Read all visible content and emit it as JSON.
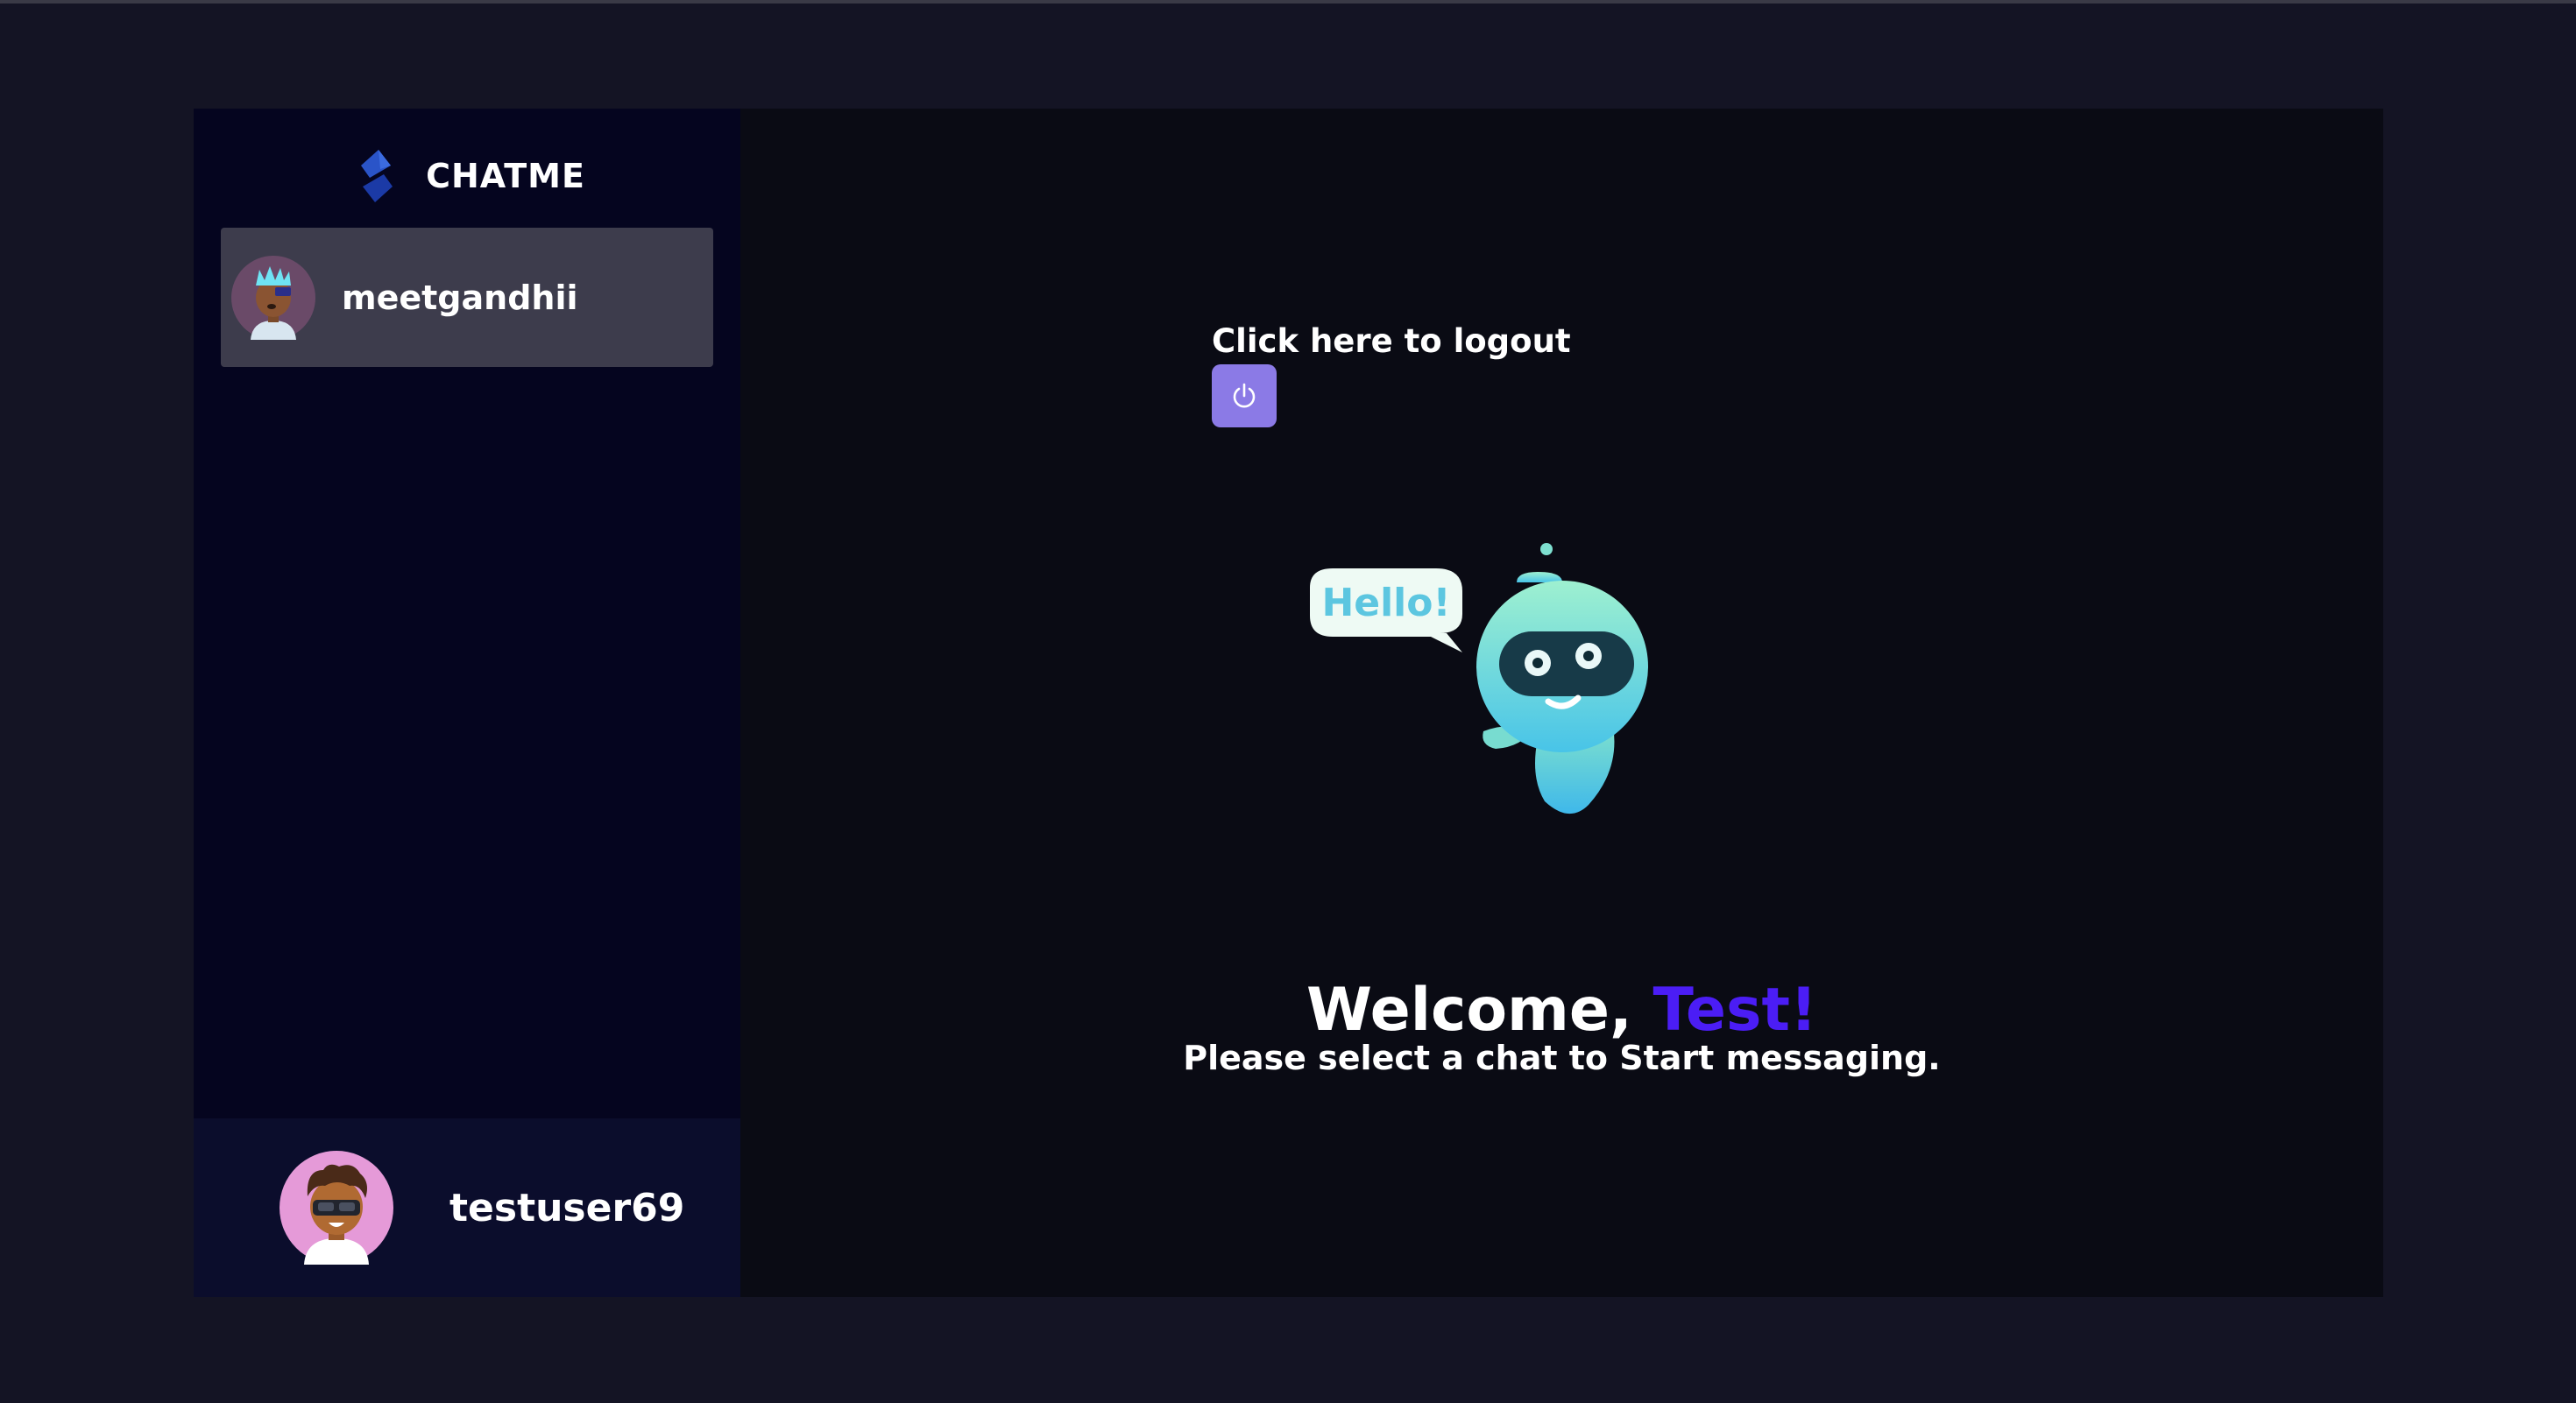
{
  "brand": {
    "name": "CHATME",
    "logo_icon": "diamond-logo-icon"
  },
  "contacts": [
    {
      "username": "meetgandhii",
      "avatar_icon": "avatar-icon"
    }
  ],
  "current_user": {
    "username": "testuser69",
    "avatar_icon": "avatar-icon"
  },
  "main": {
    "logout_label": "Click here to logout",
    "logout_icon": "power-icon",
    "welcome_prefix": "Welcome,",
    "welcome_name": "Test!",
    "subtitle": "Please select a chat to Start messaging.",
    "illustration": {
      "speech_bubble_text": "Hello!"
    }
  },
  "colors": {
    "background": "#141424",
    "sidebar": "#05051f",
    "main_panel": "#0a0b14",
    "selected_contact": "#3d3c4c",
    "current_user_bar": "#0b0d2c",
    "logout_button": "#8b7ae6",
    "welcome_name": "#4b1df5"
  }
}
